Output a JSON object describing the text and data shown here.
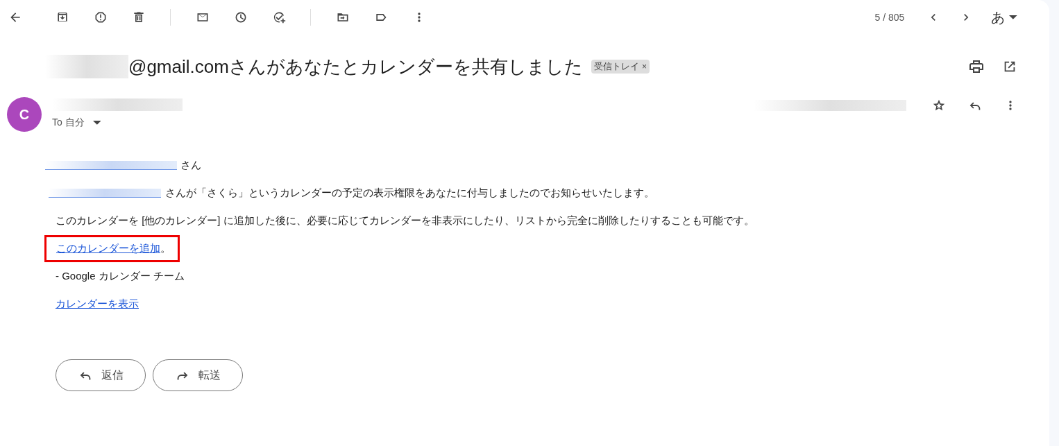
{
  "toolbar": {
    "counter": "5 / 805",
    "input_tool": "あ"
  },
  "subject": {
    "title": "@gmail.comさんがあなたとカレンダーを共有しました",
    "label": "受信トレイ",
    "label_close": "×"
  },
  "message": {
    "avatar": "C",
    "recipient": "To 自分",
    "body": [
      {
        "kind": "greeting",
        "text": "さん"
      },
      {
        "kind": "sender_line",
        "text": "さんが「さくら」というカレンダーの予定の表示権限をあなたに付与しましたのでお知らせいたします。"
      },
      {
        "kind": "text",
        "text": "このカレンダーを [他のカレンダー] に追加した後に、必要に応じてカレンダーを非表示にしたり、リストから完全に削除したりすることも可能です。"
      },
      {
        "kind": "link",
        "text": "このカレンダーを追加",
        "suffix": "。",
        "highlighted": true
      },
      {
        "kind": "text",
        "text": "- Google カレンダー チーム"
      },
      {
        "kind": "link",
        "text": "カレンダーを表示",
        "highlighted": false
      }
    ]
  },
  "actions": [
    {
      "kind": "reply",
      "label": "返信"
    },
    {
      "kind": "forward",
      "label": "転送"
    }
  ]
}
